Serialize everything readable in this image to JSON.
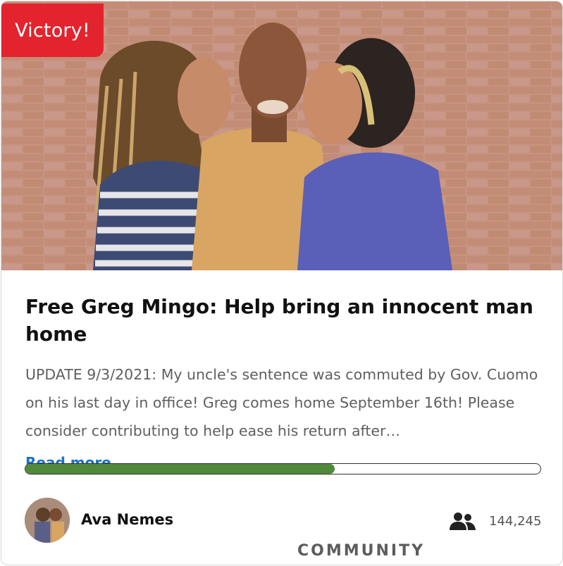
{
  "badge": {
    "label": "Victory!",
    "color": "#e3232d"
  },
  "petition": {
    "title": "Free Greg Mingo: Help bring an innocent man home",
    "description": "UPDATE 9/3/2021: My uncle's sentence was commuted by Gov. Cuomo on his last day in office! Greg comes home September 16th! Please consider contributing to help ease his return after…",
    "read_more": "Read more",
    "progress_fraction": 0.6,
    "progress_color": "#4f8a3a"
  },
  "author": {
    "name": "Ava Nemes"
  },
  "supporters": {
    "icon": "people-icon",
    "count": "144,245"
  },
  "footer": {
    "label": "COMMUNITY"
  }
}
